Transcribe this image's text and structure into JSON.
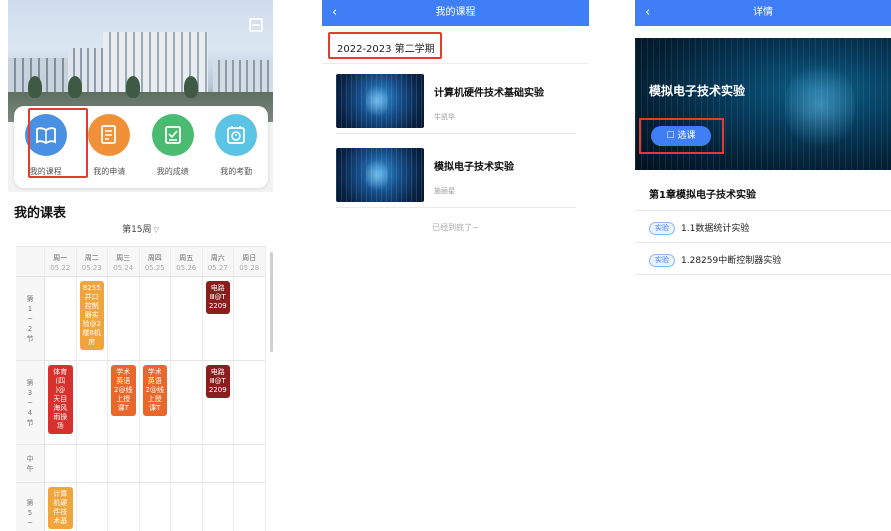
{
  "panel1": {
    "menu": [
      {
        "label": "我的课程",
        "icon": "book-icon",
        "color": "#4a90e2"
      },
      {
        "label": "我的申请",
        "icon": "application-form-icon",
        "color": "#f0913a"
      },
      {
        "label": "我的成绩",
        "icon": "grades-icon",
        "color": "#4cbb72"
      },
      {
        "label": "我的考勤",
        "icon": "attendance-clock-icon",
        "color": "#5bc3e3"
      }
    ],
    "schedule_title": "我的课表",
    "week": "第15周",
    "days": [
      {
        "day": "周一",
        "date": "05.22"
      },
      {
        "day": "周二",
        "date": "05.23"
      },
      {
        "day": "周三",
        "date": "05.24"
      },
      {
        "day": "周四",
        "date": "05.25"
      },
      {
        "day": "周五",
        "date": "05.26"
      },
      {
        "day": "周六",
        "date": "05.27"
      },
      {
        "day": "周日",
        "date": "05.28"
      }
    ],
    "periods": [
      "第\n1\n~\n2\n节",
      "第\n3\n~\n4\n节",
      "中\n午",
      "第\n5\n~"
    ],
    "courses": [
      {
        "period": 0,
        "day": 1,
        "text": "8255\n并口\n控制\n器实\n验@2\n楼8机\n房",
        "color": "#f0a53c"
      },
      {
        "period": 0,
        "day": 5,
        "text": "电路\nⅢ@T\n2209",
        "color": "#8b1d1d"
      },
      {
        "period": 1,
        "day": 0,
        "text": "体育\n(四\n)@\n天目\n海风\n雨操\n场",
        "color": "#d8302d"
      },
      {
        "period": 1,
        "day": 2,
        "text": "学术\n英语\n2@线\n上授\n课T",
        "color": "#e8672a"
      },
      {
        "period": 1,
        "day": 3,
        "text": "学术\n英语\n2@线\n上授\n课T",
        "color": "#e8672a"
      },
      {
        "period": 1,
        "day": 5,
        "text": "电路\nⅢ@T\n2209",
        "color": "#8b1d1d"
      },
      {
        "period": 3,
        "day": 0,
        "text": "计算\n机硬\n件技\n术基",
        "color": "#f0a53c"
      }
    ]
  },
  "panel2": {
    "title": "我的课程",
    "term": "2022-2023 第二学期",
    "courses": [
      {
        "name": "计算机硬件技术基础实验",
        "teacher": "牛凯华"
      },
      {
        "name": "模拟电子技术实验",
        "teacher": "施丽星"
      }
    ],
    "end_text": "已经到底了~"
  },
  "panel3": {
    "title": "详情",
    "course_title": "模拟电子技术实验",
    "enroll_label": "选课",
    "chapter": "第1章模拟电子技术实验",
    "lessons": [
      {
        "tag": "实验",
        "name": "1.1数据统计实验"
      },
      {
        "tag": "实验",
        "name": "1.28259中断控制器实验"
      }
    ]
  },
  "colors": {
    "accent": "#3f7ef5",
    "highlight": "#e23b2f"
  }
}
